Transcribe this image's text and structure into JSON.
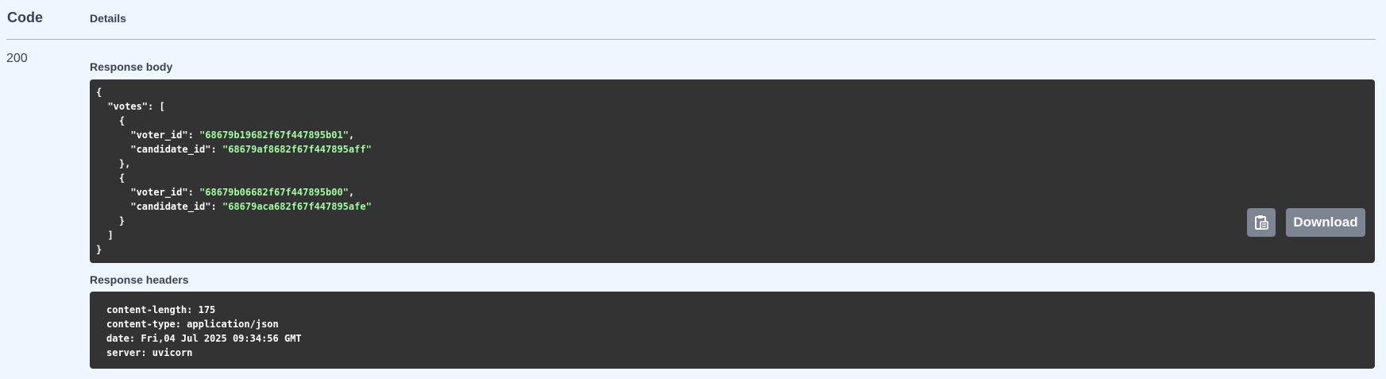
{
  "table_header": {
    "code_label": "Code",
    "details_label": "Details"
  },
  "response": {
    "status_code": "200",
    "body_label": "Response body",
    "headers_label": "Response headers",
    "body_lines": [
      {
        "indent": "",
        "key": "",
        "sep": "{",
        "value": "",
        "tail": ""
      },
      {
        "indent": "  ",
        "key": "\"votes\"",
        "sep": ": [",
        "value": "",
        "tail": ""
      },
      {
        "indent": "    ",
        "key": "",
        "sep": "{",
        "value": "",
        "tail": ""
      },
      {
        "indent": "      ",
        "key": "\"voter_id\"",
        "sep": ": ",
        "value": "\"68679b19682f67f447895b01\"",
        "tail": ","
      },
      {
        "indent": "      ",
        "key": "\"candidate_id\"",
        "sep": ": ",
        "value": "\"68679af8682f67f447895aff\"",
        "tail": ""
      },
      {
        "indent": "    ",
        "key": "",
        "sep": "},",
        "value": "",
        "tail": ""
      },
      {
        "indent": "    ",
        "key": "",
        "sep": "{",
        "value": "",
        "tail": ""
      },
      {
        "indent": "      ",
        "key": "\"voter_id\"",
        "sep": ": ",
        "value": "\"68679b06682f67f447895b00\"",
        "tail": ","
      },
      {
        "indent": "      ",
        "key": "\"candidate_id\"",
        "sep": ": ",
        "value": "\"68679aca682f67f447895afe\"",
        "tail": ""
      },
      {
        "indent": "    ",
        "key": "",
        "sep": "}",
        "value": "",
        "tail": ""
      },
      {
        "indent": "  ",
        "key": "",
        "sep": "]",
        "value": "",
        "tail": ""
      },
      {
        "indent": "",
        "key": "",
        "sep": "}",
        "value": "",
        "tail": ""
      }
    ],
    "headers_lines": [
      "content-length: 175",
      "content-type: application/json",
      "date: Fri,04 Jul 2025 09:34:56 GMT",
      "server: uvicorn"
    ],
    "download_label": "Download",
    "copy_icon": "clipboard-icon"
  },
  "colors": {
    "page_bg": "#eef6ff",
    "code_bg": "#333333",
    "json_string": "#a2fca2",
    "button_bg": "#7d8492",
    "text": "#3b4151"
  }
}
